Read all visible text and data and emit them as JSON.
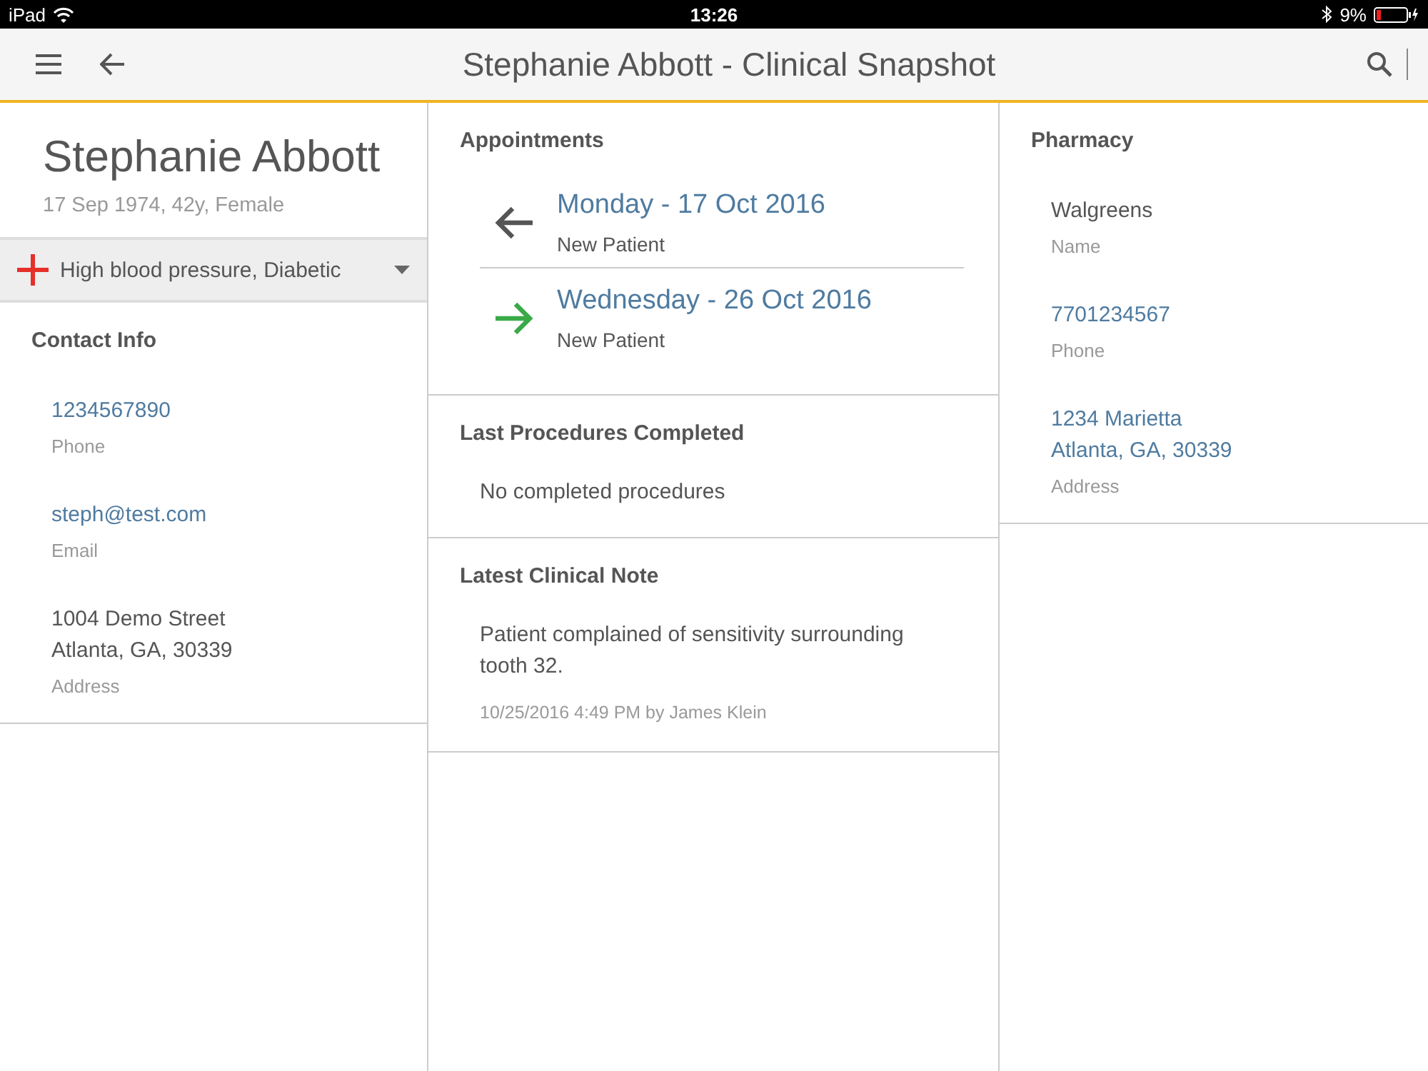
{
  "status_bar": {
    "device": "iPad",
    "time": "13:26",
    "battery": "9%"
  },
  "header": {
    "title": "Stephanie Abbott - Clinical Snapshot"
  },
  "patient": {
    "name": "Stephanie Abbott",
    "details": "17 Sep 1974, 42y, Female",
    "conditions": "High blood pressure, Diabetic"
  },
  "contact_info": {
    "title": "Contact Info",
    "fields": [
      {
        "value": "1234567890",
        "label": "Phone",
        "kind": "link"
      },
      {
        "value": "steph@test.com",
        "label": "Email",
        "kind": "link"
      },
      {
        "value": "1004 Demo Street\nAtlanta, GA, 30339",
        "label": "Address",
        "kind": "plain"
      }
    ]
  },
  "appointments": {
    "title": "Appointments",
    "items": [
      {
        "date": "Monday - 17 Oct 2016",
        "type": "New Patient",
        "kind": "past"
      },
      {
        "date": "Wednesday - 26 Oct 2016",
        "type": "New Patient",
        "kind": "upcoming"
      }
    ]
  },
  "last_procedures": {
    "title": "Last Procedures Completed",
    "text": "No completed procedures"
  },
  "clinical_note": {
    "title": "Latest Clinical Note",
    "text": "Patient complained of sensitivity surrounding tooth 32.",
    "meta": "10/25/2016 4:49 PM by James Klein"
  },
  "pharmacy": {
    "title": "Pharmacy",
    "fields": [
      {
        "value": "Walgreens",
        "label": "Name",
        "kind": "plain"
      },
      {
        "value": "7701234567",
        "label": "Phone",
        "kind": "link"
      },
      {
        "value": "1234 Marietta\nAtlanta, GA, 30339",
        "label": "Address",
        "kind": "link"
      }
    ]
  }
}
